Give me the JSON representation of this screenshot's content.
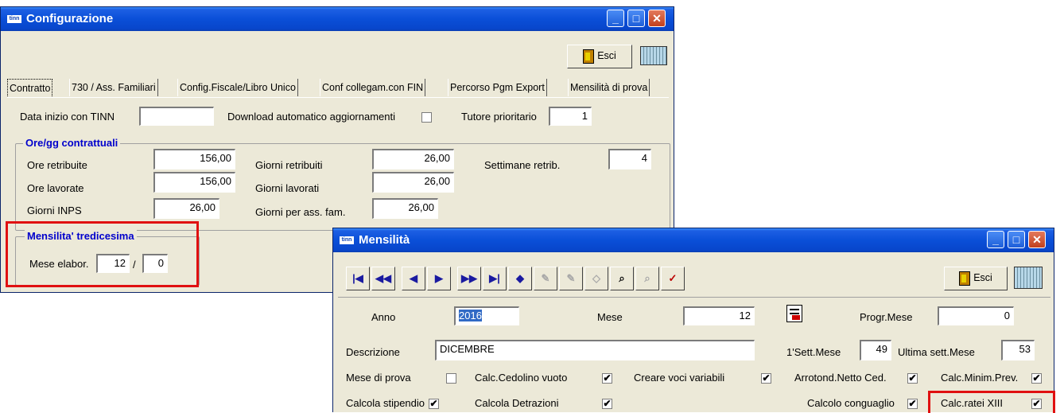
{
  "config_window": {
    "title": "Configurazione",
    "app_icon": "tinn",
    "toolbar": {
      "exit_label": "Esci"
    },
    "tabs": [
      "Contratto",
      "730 / Ass. Familiari",
      "Config.Fiscale/Libro Unico",
      "Conf collegam.con FIN",
      "Percorso Pgm Export",
      "Mensilità di prova"
    ],
    "active_tab": "Contratto",
    "data_inizio_label": "Data inizio con TINN",
    "data_inizio_value": "",
    "download_label": "Download automatico aggiornamenti",
    "download_checked": false,
    "tutore_label": "Tutore prioritario",
    "tutore_value": "1",
    "ore_group": {
      "title": "Ore/gg contrattuali",
      "ore_retribuite_label": "Ore retribuite",
      "ore_retribuite_value": "156,00",
      "ore_lavorate_label": "Ore lavorate",
      "ore_lavorate_value": "156,00",
      "giorni_inps_label": "Giorni INPS",
      "giorni_inps_value": "26,00",
      "giorni_retribuiti_label": "Giorni retribuiti",
      "giorni_retribuiti_value": "26,00",
      "giorni_lavorati_label": "Giorni lavorati",
      "giorni_lavorati_value": "26,00",
      "giorni_ass_fam_label": "Giorni per ass. fam.",
      "giorni_ass_fam_value": "26,00",
      "settimane_label": "Settimane retrib.",
      "settimane_value": "4"
    },
    "tredicesima_group": {
      "title": "Mensilita' tredicesima",
      "mese_label": "Mese elabor.",
      "mese_value": "12",
      "separator": "/",
      "mese_value2": "0"
    }
  },
  "mensilita_window": {
    "title": "Mensilità",
    "app_icon": "tinn",
    "toolbar": {
      "exit_label": "Esci"
    },
    "nav_icons": [
      "first-icon",
      "prev-page-icon",
      "prev-icon",
      "next-icon",
      "next-page-icon",
      "last-icon",
      "new-record-icon",
      "edit-icon",
      "copy-icon",
      "delete-icon",
      "search-icon",
      "search-next-icon",
      "clear-icon"
    ],
    "anno_label": "Anno",
    "anno_value": "2016",
    "mese_label": "Mese",
    "mese_value": "12",
    "progr_mese_label": "Progr.Mese",
    "progr_mese_value": "0",
    "descrizione_label": "Descrizione",
    "descrizione_value": "DICEMBRE",
    "primo_sett_label": "1'Sett.Mese",
    "primo_sett_value": "49",
    "ultima_sett_label": "Ultima sett.Mese",
    "ultima_sett_value": "53",
    "checks": {
      "mese_prova": {
        "label": "Mese di prova",
        "checked": false
      },
      "calc_cedolino_vuoto": {
        "label": "Calc.Cedolino vuoto",
        "checked": true
      },
      "creare_voci": {
        "label": "Creare voci variabili",
        "checked": true
      },
      "arrotond": {
        "label": "Arrotond.Netto Ced.",
        "checked": true
      },
      "calc_minim": {
        "label": "Calc.Minim.Prev.",
        "checked": true
      },
      "calcola_stipendio": {
        "label": "Calcola stipendio",
        "checked": true
      },
      "calcola_detrazioni": {
        "label": "Calcola Detrazioni",
        "checked": true
      },
      "calcolo_conguaglio": {
        "label": "Calcolo conguaglio",
        "checked": true
      },
      "calc_ratei": {
        "label": "Calc.ratei XIII",
        "checked": true
      }
    },
    "check_glyph": "✔"
  },
  "colors": {
    "window_bg": "#ece9d8",
    "title_bar": "#0a4fd8",
    "group_title": "#0000cc",
    "highlight": "#e01010"
  }
}
